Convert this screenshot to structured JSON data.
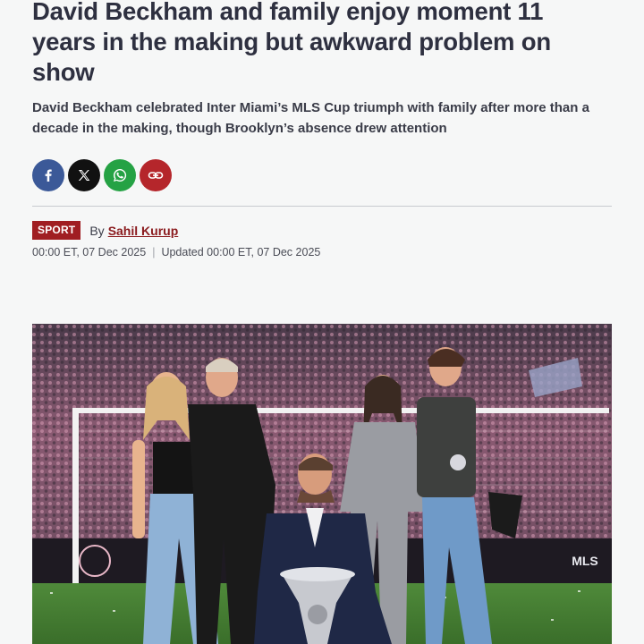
{
  "article": {
    "headline": "David Beckham and family enjoy moment 11 years in the making but awkward problem on show",
    "standfirst": "David Beckham celebrated Inter Miami’s MLS Cup triumph with family after more than a decade in the making, though Brooklyn’s absence drew attention",
    "category": "SPORT",
    "by_label": "By",
    "author": "Sahil Kurup",
    "published": "00:00 ET, 07 Dec 2025",
    "separator": "|",
    "updated": "Updated 00:00 ET, 07 Dec 2025"
  },
  "share": {
    "buttons": [
      {
        "name": "facebook",
        "icon": "facebook-icon",
        "color": "#3b5998"
      },
      {
        "name": "x",
        "icon": "x-icon",
        "color": "#111111"
      },
      {
        "name": "whatsapp",
        "icon": "whatsapp-icon",
        "color": "#25a244"
      },
      {
        "name": "copy-link",
        "icon": "link-icon",
        "color": "#b5262b"
      }
    ]
  },
  "image": {
    "stadium_sign": "MLS"
  },
  "colors": {
    "accent": "#a01e22",
    "headline": "#2e3040",
    "background": "#f6f7f7"
  }
}
